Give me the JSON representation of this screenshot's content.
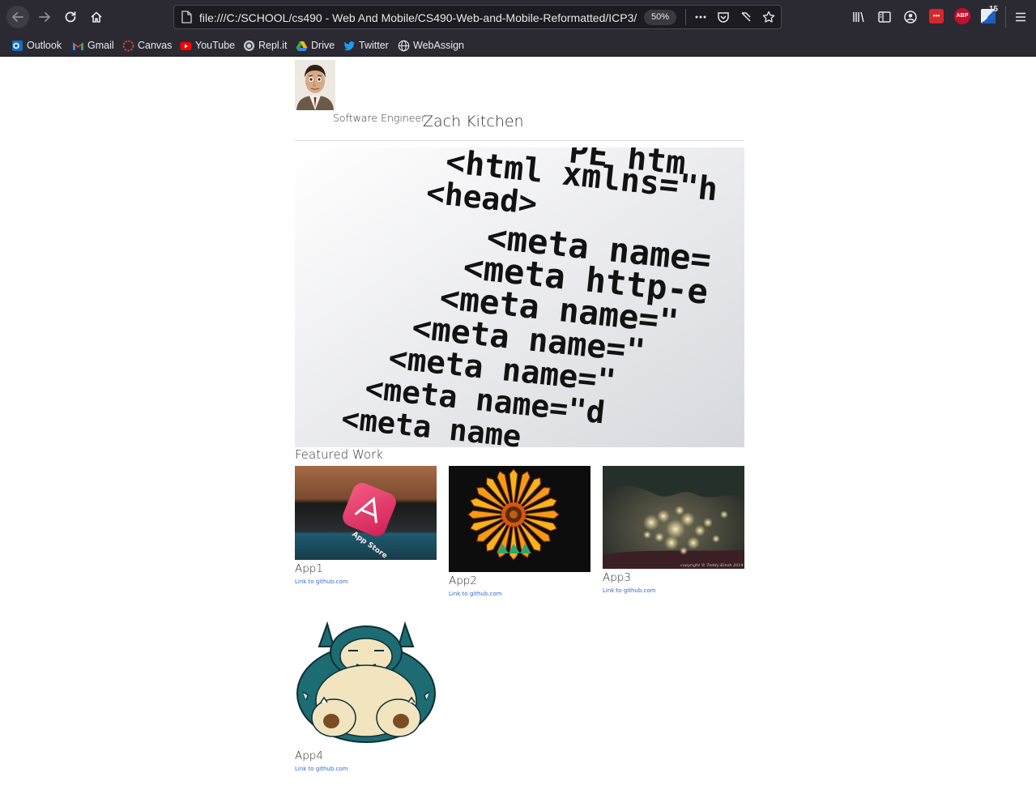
{
  "browser": {
    "url": "file:///C:/SCHOOL/cs490 - Web And Mobile/CS490-Web-and-Mobile-Reformatted/ICP3/",
    "zoom": "50%",
    "extension_badge": "15",
    "ext_abp_label": "ABP",
    "ext_red_label": "•••"
  },
  "bookmarks": [
    {
      "label": "Outlook",
      "icon": "outlook-icon"
    },
    {
      "label": "Gmail",
      "icon": "gmail-icon"
    },
    {
      "label": "Canvas",
      "icon": "canvas-icon"
    },
    {
      "label": "YouTube",
      "icon": "youtube-icon"
    },
    {
      "label": "Repl.it",
      "icon": "replit-icon"
    },
    {
      "label": "Drive",
      "icon": "drive-icon"
    },
    {
      "label": "Twitter",
      "icon": "twitter-icon"
    },
    {
      "label": "WebAssign",
      "icon": "globe-icon"
    }
  ],
  "header": {
    "role": "Software Engineer",
    "name": "Zach Kitchen"
  },
  "hero": {
    "code_lines": [
      "<html xmlns=\"h",
      "<head>",
      "<meta name=",
      "<meta http-e",
      "<meta name=\"",
      "<meta name=\"",
      "<meta name=\"",
      "<meta name=\"d",
      "<meta name"
    ],
    "code_top": "PE htm"
  },
  "featured": {
    "title": "Featured Work",
    "items": [
      {
        "label": "App1",
        "link": "Link to github.com",
        "app_store_text": "App Store"
      },
      {
        "label": "App2",
        "link": "Link to github.com"
      },
      {
        "label": "App3",
        "link": "Link to github.com",
        "copyright": "copyright © Teddy Kinsh 2014"
      },
      {
        "label": "App4",
        "link": "Link to github.com"
      }
    ]
  },
  "colors": {
    "chrome_bg": "#2b2a33",
    "link": "#2f6bd1",
    "text": "#333333"
  }
}
